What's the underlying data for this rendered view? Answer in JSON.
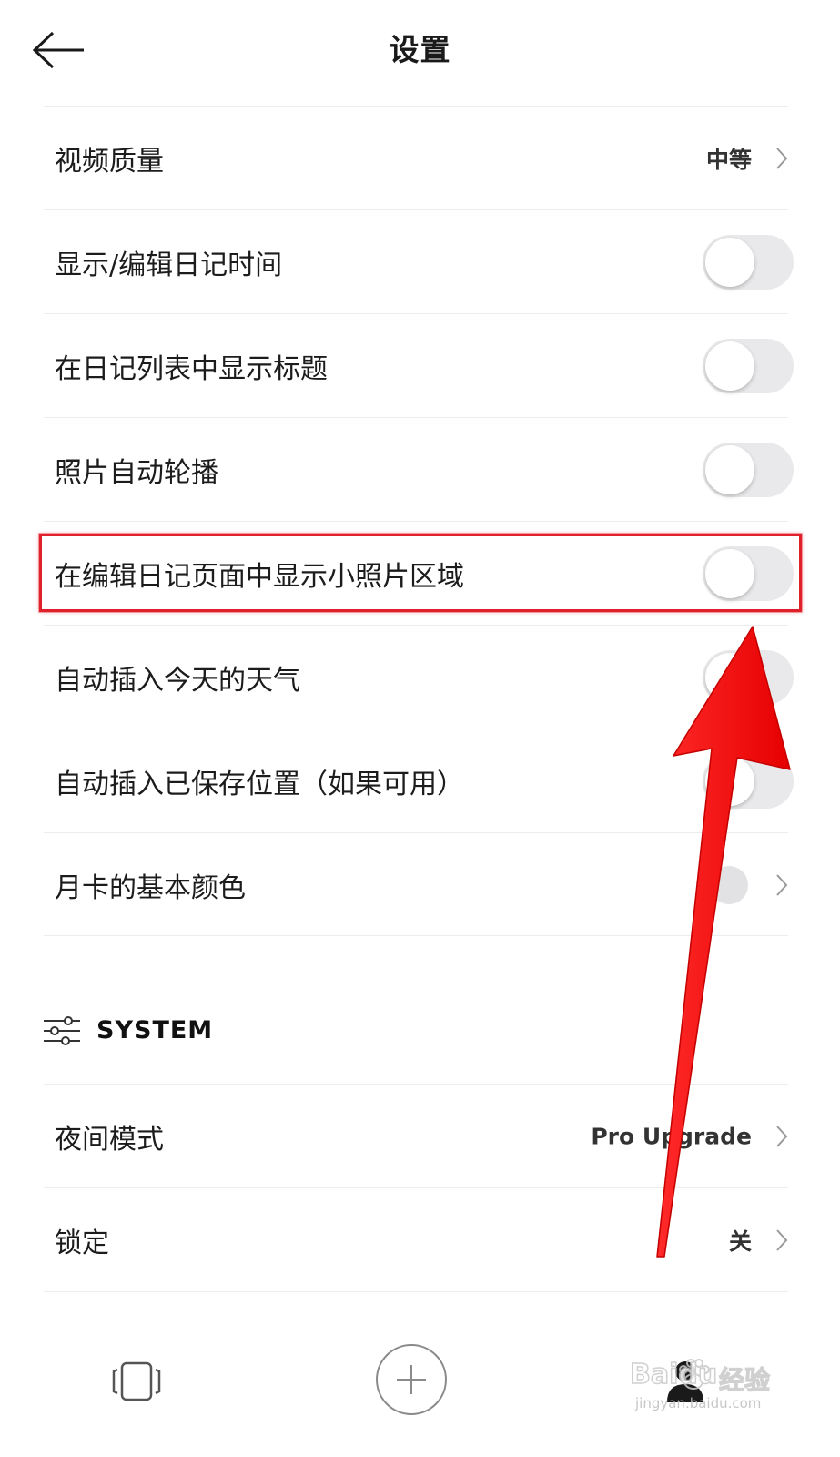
{
  "header": {
    "title": "设置",
    "back_icon": "arrow-left-icon"
  },
  "settings": {
    "video_quality": {
      "label": "视频质量",
      "value": "中等"
    },
    "show_edit_time": {
      "label": "显示/编辑日记时间",
      "enabled": false
    },
    "show_title_in_list": {
      "label": "在日记列表中显示标题",
      "enabled": false
    },
    "photo_carousel": {
      "label": "照片自动轮播",
      "enabled": false
    },
    "show_small_photo_area": {
      "label": "在编辑日记页面中显示小照片区域",
      "enabled": false
    },
    "insert_weather": {
      "label": "自动插入今天的天气",
      "enabled": false
    },
    "insert_location": {
      "label": "自动插入已保存位置（如果可用）",
      "enabled": false
    },
    "month_card_color": {
      "label": "月卡的基本颜色"
    }
  },
  "system": {
    "title": "SYSTEM",
    "icon": "sliders-icon",
    "night_mode": {
      "label": "夜间模式",
      "value": "Pro Upgrade"
    },
    "lock": {
      "label": "锁定",
      "value": "关"
    }
  },
  "tabbar": {
    "items": [
      "cards-icon",
      "add-icon",
      "profile-icon"
    ]
  },
  "watermark": {
    "brand": "Baidu",
    "suffix": "经验",
    "url": "jingyan.baidu.com"
  },
  "colors": {
    "highlight": "#e0212b",
    "toggle_off": "#e9e9eb",
    "divider": "#ececec"
  }
}
